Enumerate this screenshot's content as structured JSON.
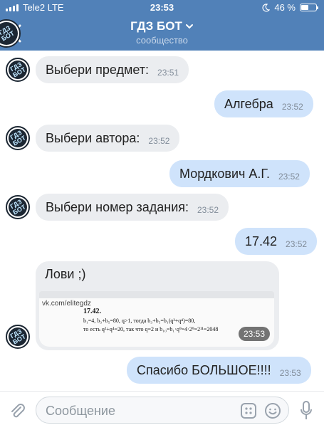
{
  "status_bar": {
    "carrier": "Tele2 LTE",
    "time": "23:53",
    "battery": "46 %"
  },
  "header": {
    "title": "ГДЗ БОТ",
    "subtitle": "сообщество",
    "avatar_text": "ГДЗ БОТ"
  },
  "messages": [
    {
      "direction": "in",
      "text": "Выбери предмет:",
      "time": "23:51"
    },
    {
      "direction": "out",
      "text": "Алгебра",
      "time": "23:52"
    },
    {
      "direction": "in",
      "text": "Выбери автора:",
      "time": "23:52"
    },
    {
      "direction": "out",
      "text": "Мордкович А.Г.",
      "time": "23:52"
    },
    {
      "direction": "in",
      "text": "Выбери номер задания:",
      "time": "23:52"
    },
    {
      "direction": "out",
      "text": "17.42",
      "time": "23:52"
    },
    {
      "direction": "in",
      "text": "Лови ;)",
      "time": "23:53",
      "image": {
        "site": "vk.com/elitegdz",
        "number": "17.42.",
        "lines": [
          "b₁=4, b₃+b₅=80, q>1, тогда b₃+b₅=b₁(q²+q⁴)=80,",
          "то есть q²+q⁴=20, так что q=2 и b₁₀=b₁·q⁹=4·2⁹=2¹¹=2048"
        ]
      }
    },
    {
      "direction": "out",
      "text": "Спасибо БОЛЬШОЕ!!!!",
      "time": "23:53"
    }
  ],
  "composer": {
    "placeholder": "Сообщение"
  },
  "colors": {
    "header_bg": "#5181b8",
    "incoming_bubble": "#ebedf0",
    "outgoing_bubble": "#cfe3fb"
  }
}
